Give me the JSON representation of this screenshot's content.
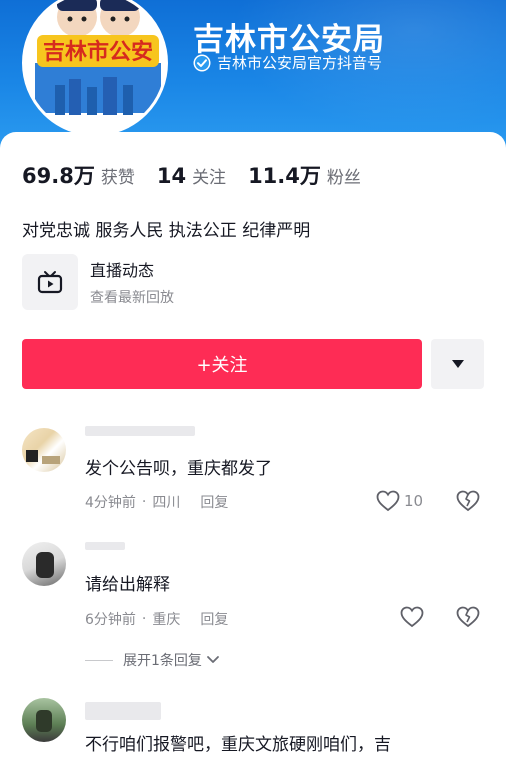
{
  "profile": {
    "name": "吉林市公安局",
    "verification": "吉林市公安局官方抖音号",
    "avatar_badge": "吉林市公安",
    "stats": [
      {
        "num": "69.8万",
        "label": "获赞"
      },
      {
        "num": "14",
        "label": "关注"
      },
      {
        "num": "11.4万",
        "label": "粉丝"
      }
    ],
    "bio": "对党忠诚 服务人民 执法公正 纪律严明"
  },
  "live": {
    "title": "直播动态",
    "subtitle": "查看最新回放",
    "icon": "tv-icon"
  },
  "actions": {
    "follow_label": "+关注",
    "more_icon": "caret-down-icon"
  },
  "comments": [
    {
      "text": "发个公告呗，重庆都发了",
      "time": "4分钟前",
      "location": "四川",
      "reply": "回复",
      "likes": "10"
    },
    {
      "text": "请给出解释",
      "time": "6分钟前",
      "location": "重庆",
      "reply": "回复",
      "likes": ""
    },
    {
      "text": "不行咱们报警吧，重庆文旅硬刚咱们，吉",
      "time": "",
      "location": "",
      "reply": "",
      "likes": ""
    }
  ],
  "expand_replies": "展开1条回复",
  "colors": {
    "header_blue": "#1a86e6",
    "follow_red": "#fe2c55",
    "muted": "#8a8b91"
  }
}
